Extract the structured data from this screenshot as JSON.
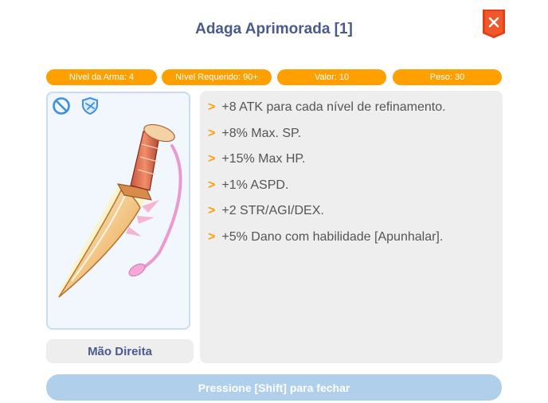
{
  "window": {
    "title": "Adaga Aprimorada [1]"
  },
  "stats": [
    {
      "label": "Nível da Arma: 4"
    },
    {
      "label": "Nível Requerido: 90+"
    },
    {
      "label": "Valor: 10"
    },
    {
      "label": "Peso: 30"
    }
  ],
  "item": {
    "equip_slot": "Mão Direita",
    "icons": [
      "forbidden-icon",
      "shield-icon",
      "dagger-icon",
      "close-icon"
    ],
    "description": [
      "+8 ATK para cada nível de refinamento.",
      "+8% Max. SP.",
      "+15% Max HP.",
      "+1% ASPD.",
      "+2 STR/AGI/DEX.",
      "+5% Dano com habilidade [Apunhalar]."
    ],
    "bullet": ">"
  },
  "footer": {
    "hint": "Pressione [Shift] para fechar"
  },
  "colors": {
    "accent": "#ff9f00",
    "title": "#4a5a8c",
    "close": "#e2401a",
    "panel": "#eeeeef",
    "footer": "#b0cfea"
  }
}
